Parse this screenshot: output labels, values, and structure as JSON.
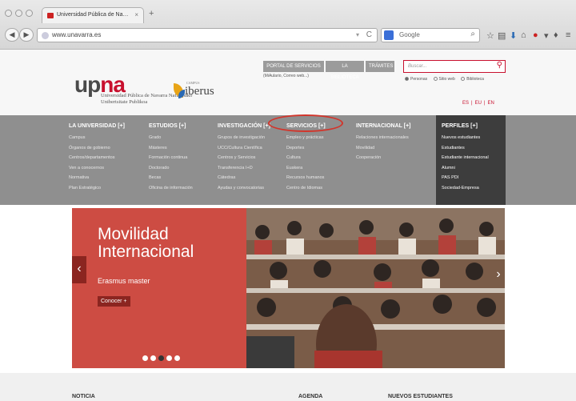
{
  "browser": {
    "tab_title": "Universidad Pública de Na…",
    "tab_close": "×",
    "new_tab": "+",
    "url": "www.unavarra.es",
    "reload": "C",
    "search_engine": "Google",
    "icons": [
      "back-icon",
      "forward-icon",
      "reader-icon",
      "globe-icon",
      "star-icon",
      "downloads-icon",
      "home-icon",
      "menu-icon"
    ]
  },
  "header": {
    "logo_up": "up",
    "logo_na": "na",
    "logo_sub": "Universidad Pública de Navarra Nafarroako Unibertsitate Publikoa",
    "iberus": "iberus",
    "iberus_tiny": "CAMPUS",
    "top_buttons": [
      "PORTAL DE SERVICIOS",
      "LA BIBLIOTECA",
      "TRÁMITES"
    ],
    "portal_sub": "(MiAulario, Correo web...)",
    "search_placeholder": "Buscar...",
    "radios": [
      "Personas",
      "Sitio web",
      "Biblioteca"
    ],
    "langs": [
      "ES",
      "EU",
      "EN"
    ]
  },
  "menu": {
    "columns": [
      {
        "title": "LA UNIVERSIDAD [+]",
        "items": [
          "Campus",
          "Órganos de gobierno",
          "Centros/departamentos",
          "Ven a conocernos",
          "Normativa",
          "Plan Estratégico"
        ]
      },
      {
        "title": "ESTUDIOS [+]",
        "items": [
          "Grado",
          "Másteres",
          "Formación continua",
          "Doctorado",
          "Becas",
          "Oficina de información"
        ]
      },
      {
        "title": "INVESTIGACIÓN [+]",
        "items": [
          "Grupos de investigación",
          "UCC/Cultura Científica",
          "Centros y Servicios",
          "Transferencia I+D",
          "Cátedras",
          "Ayudas y convocatorias"
        ]
      },
      {
        "title": "SERVICIOS [+]",
        "items": [
          "Empleo y prácticas",
          "Deportes",
          "Cultura",
          "Euskera",
          "Recursos humanos",
          "Centro de Idiomas"
        ]
      },
      {
        "title": "INTERNACIONAL [+]",
        "items": [
          "Relaciones internacionales",
          "Movilidad",
          "Cooperación"
        ]
      },
      {
        "title": "PERFILES [+]",
        "items": [
          "Nuevos estudiantes",
          "Estudiantes",
          "Estudiante internacional",
          "Alumni",
          "PAS    PDI",
          "Sociedad-Empresa"
        ]
      }
    ]
  },
  "hero": {
    "title": "Movilidad Internacional",
    "subtitle": "Erasmus master",
    "button": "Conocer +",
    "arrow_left": "‹",
    "arrow_right": "›",
    "slide_count": 5,
    "active_slide": 3
  },
  "sections": [
    "NOTICIA",
    "AGENDA",
    "NUEVOS ESTUDIANTES"
  ],
  "colors": {
    "brand_red": "#c8102e",
    "menu_gray": "#8f8f8f",
    "hero_red": "#cd4c43",
    "highlight_circle": "#d2352b"
  }
}
